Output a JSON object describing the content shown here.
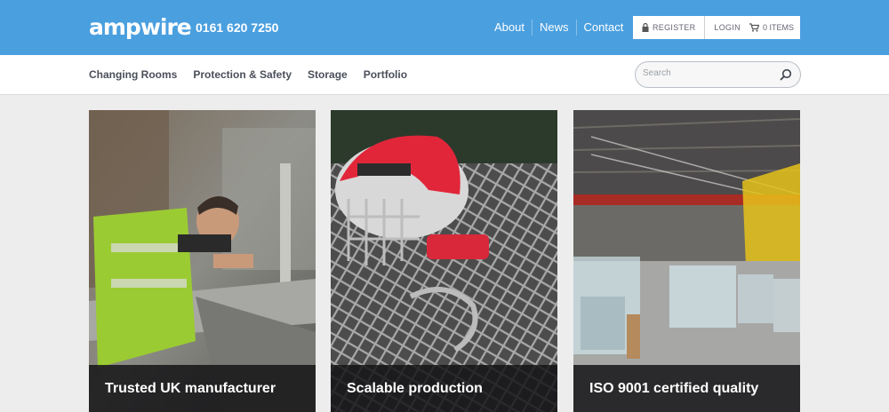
{
  "header": {
    "logo": "ampwire",
    "phone": "0161 620 7250",
    "links": [
      "About",
      "News",
      "Contact"
    ],
    "register_label": "REGISTER",
    "login_label": "LOGIN",
    "cart_label": "0 ITEMS"
  },
  "nav": {
    "items": [
      "Changing Rooms",
      "Protection & Safety",
      "Storage",
      "Portfolio"
    ]
  },
  "search": {
    "placeholder": "Search",
    "value": ""
  },
  "cards": [
    {
      "caption": "Trusted UK manufacturer"
    },
    {
      "caption": "Scalable production"
    },
    {
      "caption": "ISO 9001 certified quality"
    }
  ],
  "colors": {
    "header_blue": "#4a9fdf",
    "nav_text": "#4a4f5a",
    "caption_bg": "#141416"
  },
  "icons": [
    "lock-icon",
    "cart-icon",
    "search-icon"
  ]
}
